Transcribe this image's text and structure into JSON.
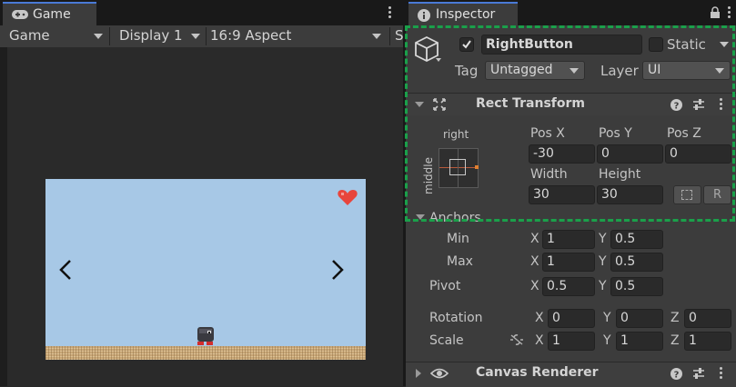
{
  "game_panel": {
    "tab_label": "Game",
    "toolbar": {
      "mode": "Game",
      "display": "Display 1",
      "aspect": "16:9 Aspect",
      "overflow_label": "S"
    },
    "scene_colors": {
      "sky": "#a7c8e6",
      "ground": "#c9a777",
      "heart": "#e8453c"
    },
    "left_arrow": "<",
    "right_arrow": ">"
  },
  "inspector": {
    "tab_label": "Inspector",
    "object": {
      "active_checked": true,
      "name": "RightButton",
      "static_label": "Static",
      "tag_label": "Tag",
      "tag_value": "Untagged",
      "layer_label": "Layer",
      "layer_value": "UI"
    },
    "rect_transform": {
      "title": "Rect Transform",
      "anchor_preset_h": "right",
      "anchor_preset_v": "middle",
      "pos_x_label": "Pos X",
      "pos_y_label": "Pos Y",
      "pos_z_label": "Pos Z",
      "pos_x": "-30",
      "pos_y": "0",
      "pos_z": "0",
      "width_label": "Width",
      "height_label": "Height",
      "width": "30",
      "height": "30",
      "raw_edit_button": "R",
      "anchors_label": "Anchors",
      "min_label": "Min",
      "max_label": "Max",
      "pivot_label": "Pivot",
      "x_label": "X",
      "y_label": "Y",
      "z_label": "Z",
      "anchor_min_x": "1",
      "anchor_min_y": "0.5",
      "anchor_max_x": "1",
      "anchor_max_y": "0.5",
      "pivot_x": "0.5",
      "pivot_y": "0.5",
      "rotation_label": "Rotation",
      "rotation_x": "0",
      "rotation_y": "0",
      "rotation_z": "0",
      "scale_label": "Scale",
      "scale_x": "1",
      "scale_y": "1",
      "scale_z": "1"
    },
    "canvas_renderer": {
      "title": "Canvas Renderer"
    },
    "highlight_color": "#1aa04a"
  }
}
